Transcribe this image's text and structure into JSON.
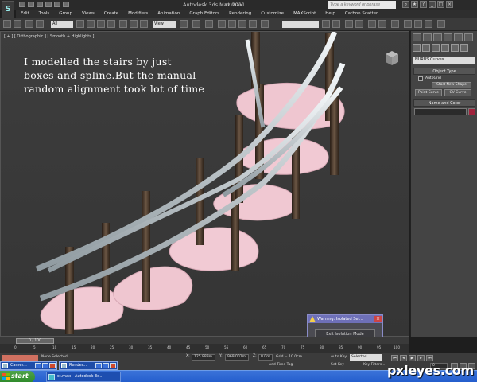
{
  "window": {
    "app_title": "Autodesk 3ds Max  2011",
    "file_name": "st.max",
    "search_placeholder": "Type a keyword or phrase"
  },
  "menu": [
    "Edit",
    "Tools",
    "Group",
    "Views",
    "Create",
    "Modifiers",
    "Animation",
    "Graph Editors",
    "Rendering",
    "Customize",
    "MAXScript",
    "Help",
    "Carbon Scatter"
  ],
  "toolbar": {
    "selection_filter": "All",
    "reference_coord": "View",
    "named_selection": ""
  },
  "viewport": {
    "label": "[ + ] [ Orthographic ] [ Smooth + Highlights ]",
    "note_lines": [
      "I modelled the stairs by just",
      "boxes and spline.But  the manual",
      "random alignment took lot of time"
    ]
  },
  "warning_dialog": {
    "title": "Warning: Isolated Sel...",
    "button": "Exit Isolation Mode"
  },
  "command_panel": {
    "category": "NURBS Curves",
    "object_type_header": "Object Type",
    "autogrid_label": "AutoGrid",
    "start_new_shape": "Start New Shape",
    "point_curve": "Point Curve",
    "cv_curve": "CV Curve",
    "name_color_header": "Name and Color",
    "name_value": ""
  },
  "timeline": {
    "slider": "0 / 100",
    "ticks": [
      "0",
      "5",
      "10",
      "15",
      "20",
      "25",
      "30",
      "35",
      "40",
      "45",
      "50",
      "55",
      "60",
      "65",
      "70",
      "75",
      "80",
      "85",
      "90",
      "95",
      "100"
    ]
  },
  "status": {
    "selection": "None Selected",
    "x_label": "X:",
    "x_value": "125.889m",
    "y_label": "Y:",
    "y_value": "969.001m",
    "z_label": "Z:",
    "z_value": "0.0m",
    "grid": "Grid = 10.0cm",
    "add_time_tag": "Add Time Tag",
    "auto_key": "Auto Key",
    "selected": "Selected",
    "set_key": "Set Key",
    "key_filters": "Key Filters...",
    "frame": "0"
  },
  "floating_tasks": [
    {
      "label": "Camer..."
    },
    {
      "label": "Render..."
    }
  ],
  "taskbar": {
    "start": "start",
    "app": "st.max - Autodesk 3d..."
  },
  "watermark": "pxleyes.com"
}
